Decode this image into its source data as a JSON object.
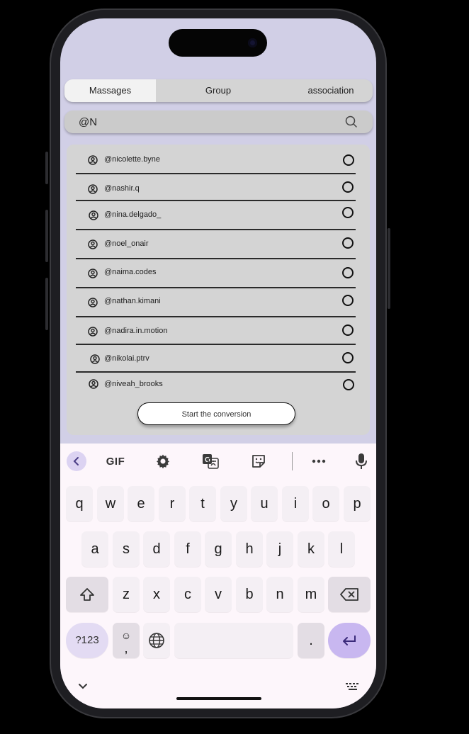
{
  "tabs": [
    {
      "label": "Massages",
      "active": true
    },
    {
      "label": "Group",
      "active": false
    },
    {
      "label": "association",
      "active": false
    }
  ],
  "search": {
    "value": "@N"
  },
  "contacts": [
    {
      "handle": "@nicolette.byne"
    },
    {
      "handle": "@nashir.q"
    },
    {
      "handle": "@nina.delgado_"
    },
    {
      "handle": "@noel_onair"
    },
    {
      "handle": "@naima.codes"
    },
    {
      "handle": "@nathan.kimani"
    },
    {
      "handle": "@nadira.in.motion"
    },
    {
      "handle": "@nikolai.ptrv"
    },
    {
      "handle": "@niveah_brooks"
    }
  ],
  "start_button": {
    "label": "Start the conversion"
  },
  "keyboard": {
    "toolbar": {
      "gif": "GIF"
    },
    "row1": [
      "q",
      "w",
      "e",
      "r",
      "t",
      "y",
      "u",
      "i",
      "o",
      "p"
    ],
    "row2": [
      "a",
      "s",
      "d",
      "f",
      "g",
      "h",
      "j",
      "k",
      "l"
    ],
    "row3": [
      "z",
      "x",
      "c",
      "v",
      "b",
      "n",
      "m"
    ],
    "num_key": "?123",
    "comma_key": ",",
    "period_key": "."
  },
  "colors": {
    "screen_bg": "#d1cfe6",
    "keyboard_bg": "#fdf6fb",
    "enter_key": "#c8b7f0"
  }
}
